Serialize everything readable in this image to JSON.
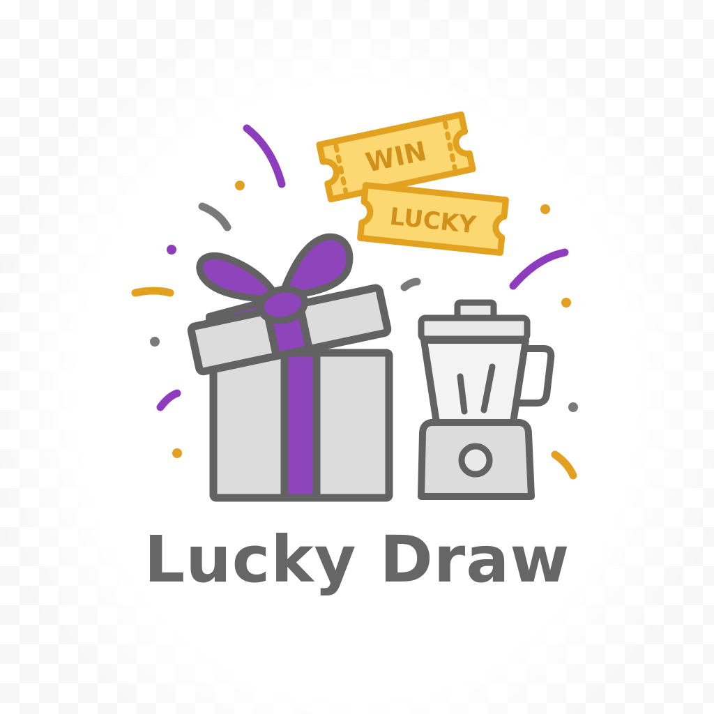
{
  "colors": {
    "outline": "#626262",
    "box_fill": "#dcdcdc",
    "ribbon": "#8e44ba",
    "ticket_fill": "#fcd873",
    "ticket_outline": "#e2a11f",
    "ticket_text": "#d1901a",
    "confetti_gold": "#e3a020",
    "confetti_purple": "#8e3cbe",
    "confetti_gray": "#7a7a7a",
    "title_text": "#666666"
  },
  "tickets": {
    "top_label": "WIN",
    "bottom_label": "LUCKY"
  },
  "illustration": {
    "icons": [
      "gift-box-icon",
      "blender-icon",
      "ticket-icon",
      "confetti"
    ]
  },
  "title": "Lucky Draw"
}
